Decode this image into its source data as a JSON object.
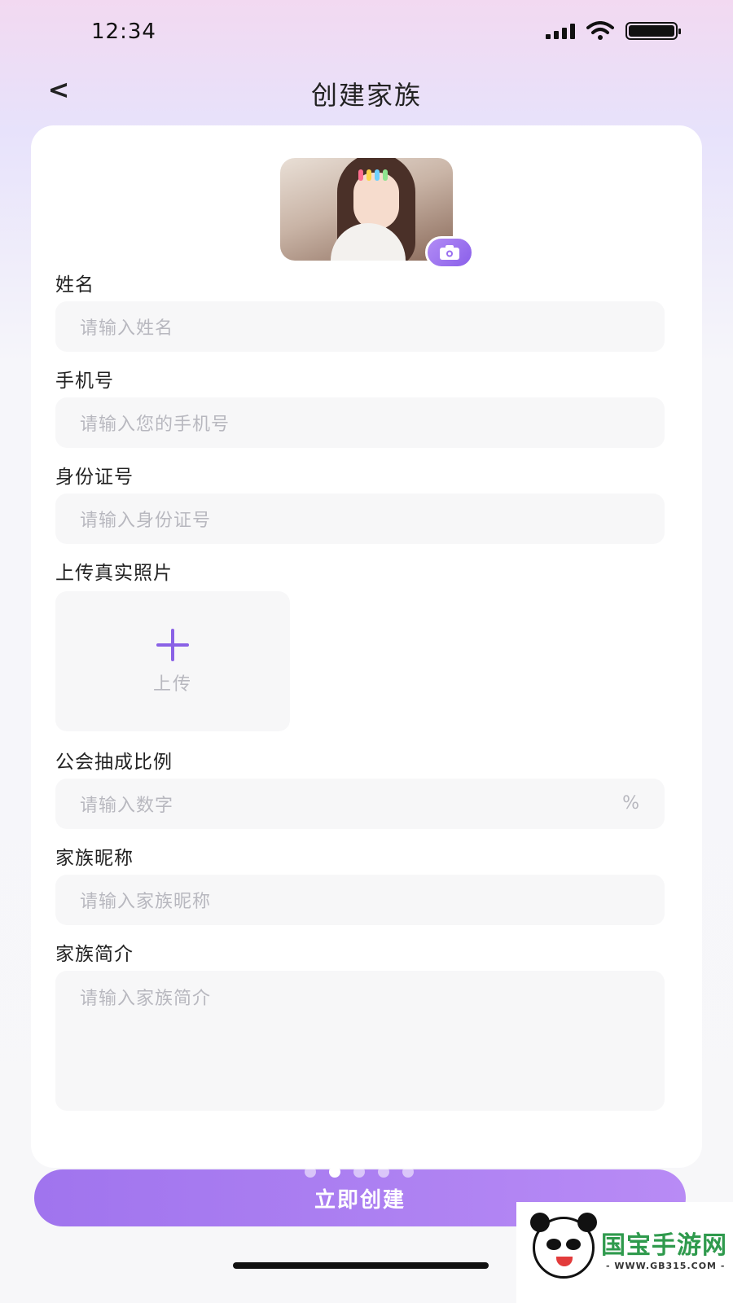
{
  "status_bar": {
    "time": "12:34"
  },
  "nav": {
    "back": "<",
    "title": "创建家族"
  },
  "form": {
    "name": {
      "label": "姓名",
      "placeholder": "请输入姓名"
    },
    "phone": {
      "label": "手机号",
      "placeholder": "请输入您的手机号"
    },
    "id_number": {
      "label": "身份证号",
      "placeholder": "请输入身份证号"
    },
    "photo": {
      "label": "上传真实照片",
      "upload_text": "上传"
    },
    "commission": {
      "label": "公会抽成比例",
      "placeholder": "请输入数字",
      "suffix": "%"
    },
    "nickname": {
      "label": "家族昵称",
      "placeholder": "请输入家族昵称"
    },
    "intro": {
      "label": "家族简介",
      "placeholder": "请输入家族简介"
    }
  },
  "submit": {
    "label": "立即创建"
  },
  "carousel": {
    "count": 5,
    "active": 2
  },
  "watermark": {
    "brand": "国宝手游网",
    "url": "- WWW.GB315.COM -"
  },
  "colors": {
    "accent": "#8a62e6",
    "button": "#a074ee",
    "input_bg": "#f7f7f8",
    "placeholder": "#b8b8bf"
  }
}
